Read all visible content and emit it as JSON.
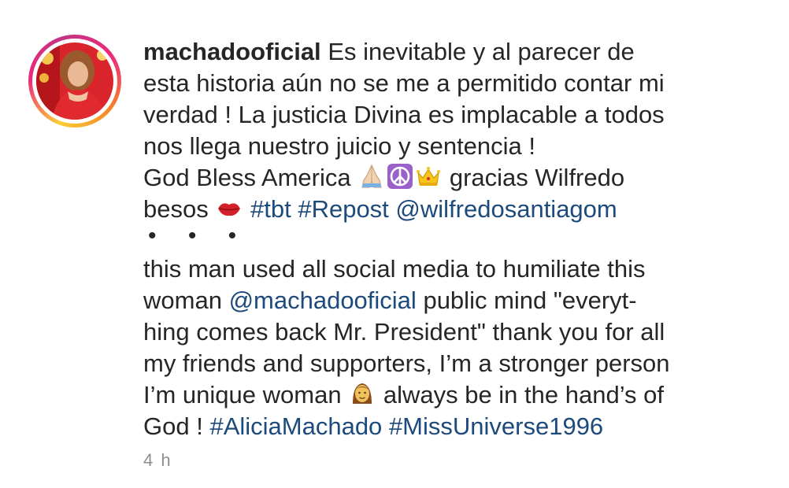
{
  "post": {
    "author": "machadooficial",
    "caption_lines": [
      "Es inevitable y al parecer de",
      "esta historia aún no se me a permitido contar mi",
      "verdad ! La justicia Divina es implacable a todos",
      "nos llega nuestro juicio y sentencia !",
      "God Bless America",
      "gracias Wilfredo",
      "besos"
    ],
    "hashtags_line1": [
      "#tbt",
      "#Repost"
    ],
    "mention_line1": "@wilfredosantiagom",
    "more_dots": "• • •",
    "repost_text": {
      "l1": "this man used all social media to humiliate this",
      "l2_pre": "woman",
      "l2_mention": "@machadooficial",
      "l2_post": "public mind \"everyt-",
      "l3": "hing comes back Mr. President\" thank you for all",
      "l4": "my friends and supporters, I’m a stronger person",
      "l5_pre": "I’m unique woman",
      "l5_post": "always be in the hand’s of",
      "l6_pre": "God !",
      "l6_tag1": "#AliciaMachado",
      "l6_tag2": "#MissUniverse1996"
    },
    "timestamp": "4 h"
  },
  "icons": {
    "emoji_1": "folded-hands-icon",
    "emoji_2": "peace-symbol-icon",
    "emoji_3": "crown-icon",
    "emoji_4": "kiss-mark-icon",
    "emoji_5": "woman-icon"
  },
  "colors": {
    "text": "#262626",
    "link": "#1c4a7c",
    "muted": "#8e8e8e",
    "story_ring": "#ee2a7b"
  }
}
